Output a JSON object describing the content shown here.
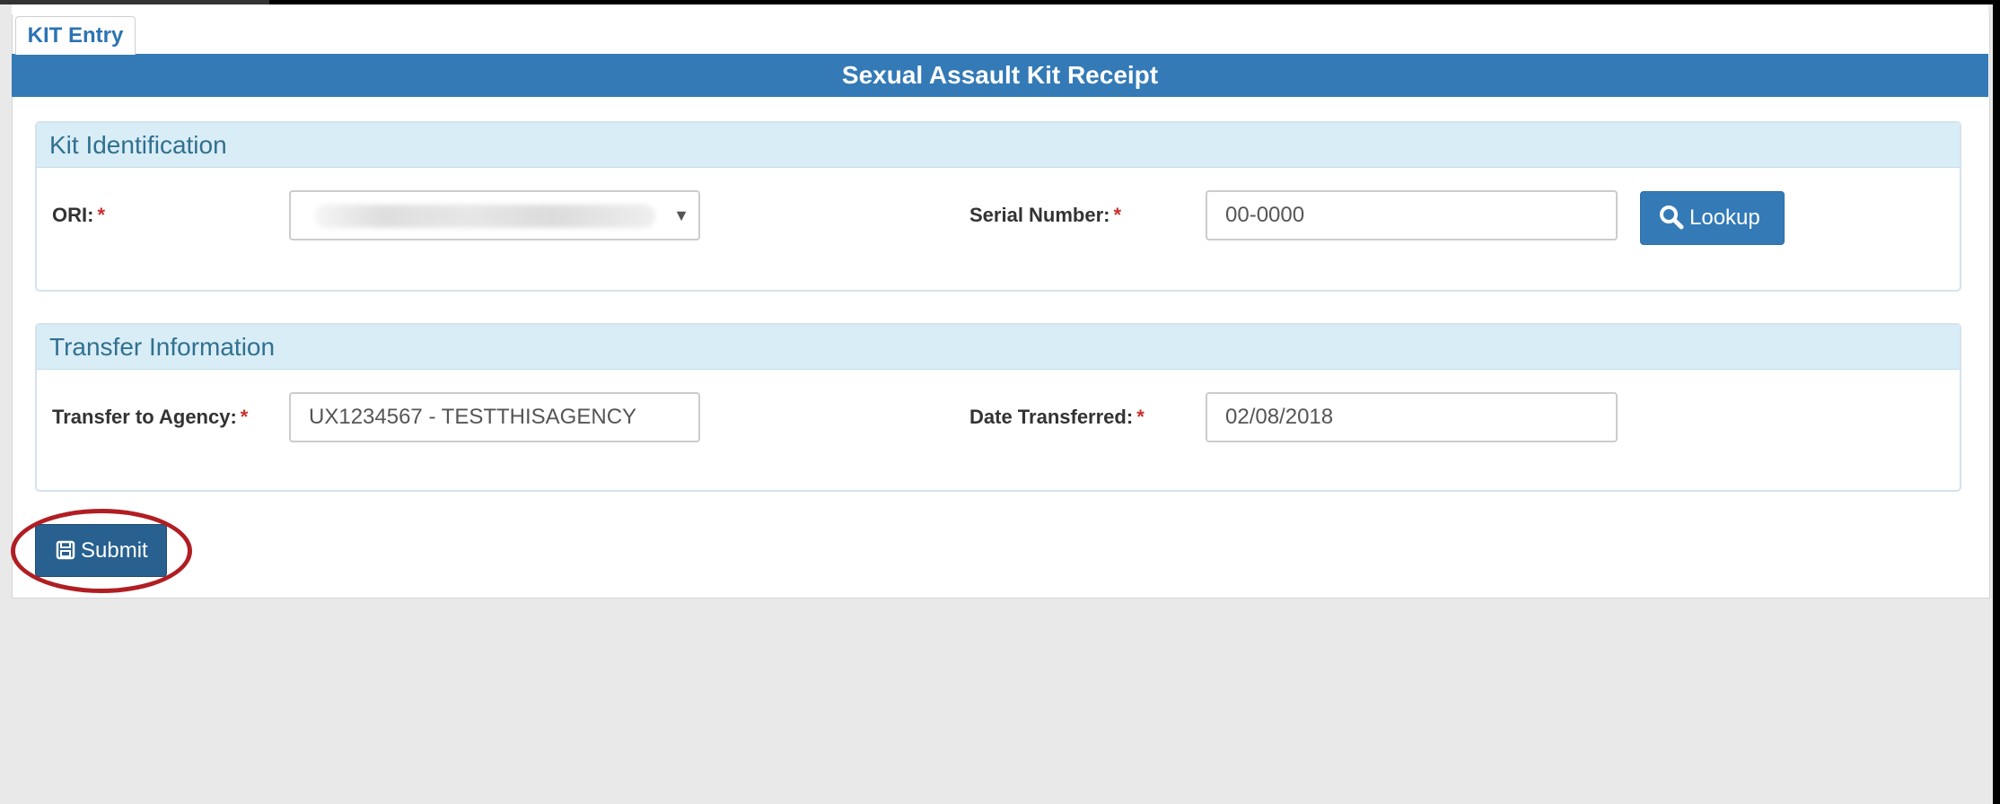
{
  "tabs": [
    {
      "label": "KIT Entry"
    }
  ],
  "header": {
    "title": "Sexual Assault Kit Receipt"
  },
  "kit_identification": {
    "heading": "Kit Identification",
    "ori": {
      "label": "ORI:",
      "required_mark": "*",
      "selected_value": ""
    },
    "serial_number": {
      "label": "Serial Number:",
      "required_mark": "*",
      "value": "00-0000"
    },
    "lookup_button": {
      "label": "Lookup",
      "icon": "search-icon"
    }
  },
  "transfer_information": {
    "heading": "Transfer Information",
    "transfer_to_agency": {
      "label": "Transfer to Agency:",
      "required_mark": "*",
      "value": "UX1234567 - TESTTHISAGENCY"
    },
    "date_transferred": {
      "label": "Date Transferred:",
      "required_mark": "*",
      "value": "02/08/2018"
    }
  },
  "submit_button": {
    "label": "Submit",
    "icon": "floppy-disk-icon"
  },
  "colors": {
    "primary": "#337ab7",
    "panel_heading_bg": "#d9edf7",
    "panel_heading_text": "#31708f",
    "required": "#c9302c",
    "annotation_ring": "#b01e23",
    "background": "#e9e9e9"
  }
}
